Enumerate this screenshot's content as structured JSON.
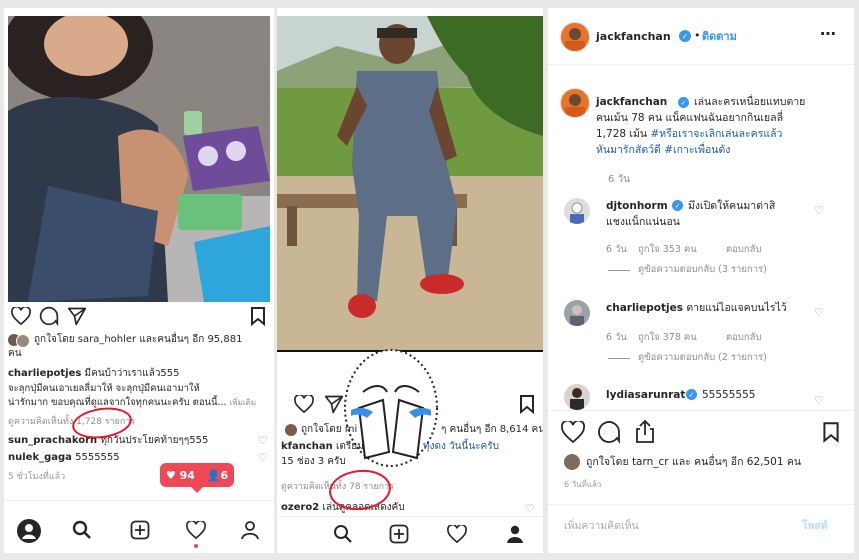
{
  "left": {
    "liked_by": "ถูกใจโดย sara_hohler และคนอื่นๆ อีก 95,881",
    "liked_by_2": "คน",
    "caption_user": "charliepotjes",
    "caption_line1": "มีคนบ้าว่าเราแล้ว555",
    "caption_line2": "จะลุกปุ่มีคนเอาเยลลี่มาให้ จะลุกปุ่มีคนเอามาให้",
    "caption_line3": "น่ารักมาก ขอบคุณที่ดูแลจากใจทุกคนนะครับ ตอนนี้...",
    "more": "เพิ่มเติม",
    "view_comments": "ดูความคิดเห็นทั้ง 1,728 รายการ",
    "comment1_user": "sun_prachakorn",
    "comment1_text": "ทุกวันประโยคท้ายๆๆ555",
    "comment2_user": "nulek_gaga",
    "comment2_text": "5555555",
    "time": "5 ชั่วโมงที่แล้ว",
    "notif_likes": "94",
    "notif_follows": "6"
  },
  "middle": {
    "liked_by": "ถูกใจโดย mi",
    "liked_by_2": "ๆ คนอื่นๆ อีก 8,614 คน",
    "caption_user": "kfanchan",
    "caption_line1": "เตรียม",
    "caption_line1b": "ทุ่งดง วันนี้นะครับ",
    "caption_line2": "15 ช่อง 3 ครับ",
    "view_comments": "ดูความคิดเห็นทั้ง 78 รายการ",
    "comment_user": "ozero2",
    "comment_text": "เล่นดูคลอดเสดงคับ"
  },
  "right": {
    "username": "jackfanchan",
    "follow": "ติดตาม",
    "caption_user": "jackfanchan",
    "caption_l1": "เล่นละครเหนื่อยแทบตาย",
    "caption_l2": "คนเม้น 78 คน แน็คแฟนฉันอยากกินเยลลี่",
    "caption_l3": "1,728 เม้น",
    "caption_tag1": "#หรือเราจะเลิกเล่นละครแล้ว",
    "caption_tag2": "หันมารักสัตว์ดี",
    "caption_tag3": "#เกาะเพื่อนดัง",
    "caption_time": "6 วัน",
    "c1_user": "djtonhorm",
    "c1_text1": "มึงเปิดให้คนมาด่าสิ",
    "c1_text2": "แชงแน็กแน่นอน",
    "c1_time": "6 วัน",
    "c1_likes": "ถูกใจ 353 คน",
    "c1_reply": "ตอบกลับ",
    "c1_view": "ดูข้อความตอบกลับ (3 รายการ)",
    "c2_user": "charliepotjes",
    "c2_text": "ตายแน่ไอแจคบนไรไว้",
    "c2_time": "6 วัน",
    "c2_likes": "ถูกใจ 378 คน",
    "c2_reply": "ตอบกลับ",
    "c2_view": "ดูข้อความตอบกลับ (2 รายการ)",
    "c3_user": "lydiasarunrat",
    "c3_text": "55555555",
    "liked_by": "ถูกใจโดย tarn_cr และ คนอื่นๆ อีก 62,501 คน",
    "time": "6 วันที่แล้ว",
    "add_comment": "เพิ่มความคิดเห็น",
    "post": "โพสต์",
    "more_icon": "⋯"
  },
  "colors": {
    "accent_red": "#ed4956",
    "link_blue": "#1e5aa8",
    "verified": "#3897f0",
    "annotation": "#e0192b"
  }
}
